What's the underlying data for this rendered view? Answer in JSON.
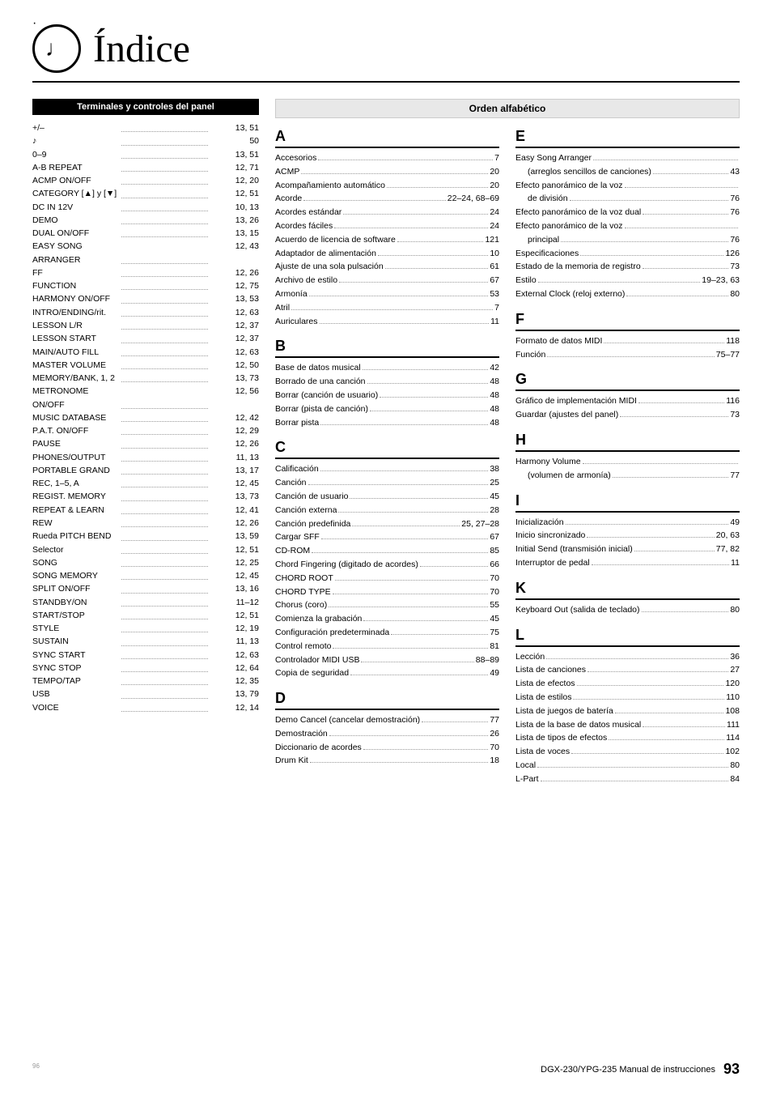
{
  "header": {
    "title": "Índice",
    "icon": "♩"
  },
  "left_panel": {
    "title": "Terminales y controles del panel",
    "entries": [
      {
        "name": "+/–",
        "page": "13, 51"
      },
      {
        "name": "♪",
        "page": "50"
      },
      {
        "name": "0–9",
        "page": "13, 51"
      },
      {
        "name": "A-B REPEAT",
        "page": "12, 71"
      },
      {
        "name": "ACMP ON/OFF",
        "page": "12, 20"
      },
      {
        "name": "CATEGORY [▲] y [▼]",
        "page": "12, 51"
      },
      {
        "name": "DC IN 12V",
        "page": "10, 13"
      },
      {
        "name": "DEMO",
        "page": "13, 26"
      },
      {
        "name": "DUAL ON/OFF",
        "page": "13, 15"
      },
      {
        "name": "EASY SONG ARRANGER",
        "page": "12, 43"
      },
      {
        "name": "FF",
        "page": "12, 26"
      },
      {
        "name": "FUNCTION",
        "page": "12, 75"
      },
      {
        "name": "HARMONY ON/OFF",
        "page": "13, 53"
      },
      {
        "name": "INTRO/ENDING/rit.",
        "page": "12, 63"
      },
      {
        "name": "LESSON L/R",
        "page": "12, 37"
      },
      {
        "name": "LESSON START",
        "page": "12, 37"
      },
      {
        "name": "MAIN/AUTO FILL",
        "page": "12, 63"
      },
      {
        "name": "MASTER VOLUME",
        "page": "12, 50"
      },
      {
        "name": "MEMORY/BANK, 1, 2",
        "page": "13, 73"
      },
      {
        "name": "METRONOME ON/OFF",
        "page": "12, 56"
      },
      {
        "name": "MUSIC DATABASE",
        "page": "12, 42"
      },
      {
        "name": "P.A.T. ON/OFF",
        "page": "12, 29"
      },
      {
        "name": "PAUSE",
        "page": "12, 26"
      },
      {
        "name": "PHONES/OUTPUT",
        "page": "11, 13"
      },
      {
        "name": "PORTABLE GRAND",
        "page": "13, 17"
      },
      {
        "name": "REC, 1–5, A",
        "page": "12, 45"
      },
      {
        "name": "REGIST. MEMORY",
        "page": "13, 73"
      },
      {
        "name": "REPEAT & LEARN",
        "page": "12, 41"
      },
      {
        "name": "REW",
        "page": "12, 26"
      },
      {
        "name": "Rueda PITCH BEND",
        "page": "13, 59"
      },
      {
        "name": "Selector",
        "page": "12, 51"
      },
      {
        "name": "SONG",
        "page": "12, 25"
      },
      {
        "name": "SONG MEMORY",
        "page": "12, 45"
      },
      {
        "name": "SPLIT ON/OFF",
        "page": "13, 16"
      },
      {
        "name": "STANDBY/ON",
        "page": "11–12"
      },
      {
        "name": "START/STOP",
        "page": "12, 51"
      },
      {
        "name": "STYLE",
        "page": "12, 19"
      },
      {
        "name": "SUSTAIN",
        "page": "11, 13"
      },
      {
        "name": "SYNC START",
        "page": "12, 63"
      },
      {
        "name": "SYNC STOP",
        "page": "12, 64"
      },
      {
        "name": "TEMPO/TAP",
        "page": "12, 35"
      },
      {
        "name": "USB",
        "page": "13, 79"
      },
      {
        "name": "VOICE",
        "page": "12, 14"
      }
    ]
  },
  "alpha_index": {
    "header": "Orden alfabético",
    "sections": [
      {
        "letter": "A",
        "entries": [
          {
            "name": "Accesorios",
            "page": "7"
          },
          {
            "name": "ACMP",
            "page": "20"
          },
          {
            "name": "Acompañamiento automático",
            "page": "20"
          },
          {
            "name": "Acorde",
            "page": "22–24, 68–69"
          },
          {
            "name": "Acordes estándar",
            "page": "24"
          },
          {
            "name": "Acordes fáciles",
            "page": "24"
          },
          {
            "name": "Acuerdo de licencia de software",
            "page": "121"
          },
          {
            "name": "Adaptador de alimentación",
            "page": "10"
          },
          {
            "name": "Ajuste de una sola pulsación",
            "page": "61"
          },
          {
            "name": "Archivo de estilo",
            "page": "67"
          },
          {
            "name": "Armonía",
            "page": "53"
          },
          {
            "name": "Atril",
            "page": "7"
          },
          {
            "name": "Auriculares",
            "page": "11"
          }
        ]
      },
      {
        "letter": "B",
        "entries": [
          {
            "name": "Base de datos musical",
            "page": "42"
          },
          {
            "name": "Borrado de una canción",
            "page": "48"
          },
          {
            "name": "Borrar (canción de usuario)",
            "page": "48"
          },
          {
            "name": "Borrar (pista de canción)",
            "page": "48"
          },
          {
            "name": "Borrar pista",
            "page": "48"
          }
        ]
      },
      {
        "letter": "C",
        "entries": [
          {
            "name": "Calificación",
            "page": "38"
          },
          {
            "name": "Canción",
            "page": "25"
          },
          {
            "name": "Canción de usuario",
            "page": "45"
          },
          {
            "name": "Canción externa",
            "page": "28"
          },
          {
            "name": "Canción predefinida",
            "page": "25, 27–28"
          },
          {
            "name": "Cargar SFF",
            "page": "67"
          },
          {
            "name": "CD-ROM",
            "page": "85"
          },
          {
            "name": "Chord Fingering (digitado de acordes)",
            "page": "66"
          },
          {
            "name": "CHORD ROOT",
            "page": "70"
          },
          {
            "name": "CHORD TYPE",
            "page": "70"
          },
          {
            "name": "Chorus (coro)",
            "page": "55"
          },
          {
            "name": "Comienza la grabación",
            "page": "45"
          },
          {
            "name": "Configuración predeterminada",
            "page": "75"
          },
          {
            "name": "Control remoto",
            "page": "81"
          },
          {
            "name": "Controlador MIDI USB",
            "page": "88–89"
          },
          {
            "name": "Copia de seguridad",
            "page": "49"
          }
        ]
      },
      {
        "letter": "D",
        "entries": [
          {
            "name": "Demo Cancel (cancelar demostración)",
            "page": "77"
          },
          {
            "name": "Demostración",
            "page": "26"
          },
          {
            "name": "Diccionario de acordes",
            "page": "70"
          },
          {
            "name": "Drum Kit",
            "page": "18"
          }
        ]
      }
    ]
  },
  "right_sections": [
    {
      "letter": "E",
      "entries": [
        {
          "name": "Easy Song Arranger",
          "page": ""
        },
        {
          "name": "  (arreglos sencillos de canciones)",
          "page": "43"
        },
        {
          "name": "Efecto panorámico de la voz",
          "page": ""
        },
        {
          "name": "  de división",
          "page": "76"
        },
        {
          "name": "Efecto panorámico de la voz dual",
          "page": "76"
        },
        {
          "name": "Efecto panorámico de la voz",
          "page": ""
        },
        {
          "name": "  principal",
          "page": "76"
        },
        {
          "name": "Especificaciones",
          "page": "126"
        },
        {
          "name": "Estado de la memoria de registro",
          "page": "73"
        },
        {
          "name": "Estilo",
          "page": "19–23, 63"
        },
        {
          "name": "External Clock (reloj externo)",
          "page": "80"
        }
      ]
    },
    {
      "letter": "F",
      "entries": [
        {
          "name": "Formato de datos MIDI",
          "page": "118"
        },
        {
          "name": "Función",
          "page": "75–77"
        }
      ]
    },
    {
      "letter": "G",
      "entries": [
        {
          "name": "Gráfico de implementación MIDI",
          "page": "116"
        },
        {
          "name": "Guardar (ajustes del panel)",
          "page": "73"
        }
      ]
    },
    {
      "letter": "H",
      "entries": [
        {
          "name": "Harmony Volume",
          "page": ""
        },
        {
          "name": "  (volumen de armonía)",
          "page": "77"
        }
      ]
    },
    {
      "letter": "I",
      "entries": [
        {
          "name": "Inicialización",
          "page": "49"
        },
        {
          "name": "Inicio sincronizado",
          "page": "20, 63"
        },
        {
          "name": "Initial Send (transmisión inicial)",
          "page": "77, 82"
        },
        {
          "name": "Interruptor de pedal",
          "page": "11"
        }
      ]
    },
    {
      "letter": "K",
      "entries": [
        {
          "name": "Keyboard Out (salida de teclado)",
          "page": "80"
        }
      ]
    },
    {
      "letter": "L",
      "entries": [
        {
          "name": "Lección",
          "page": "36"
        },
        {
          "name": "Lista de canciones",
          "page": "27"
        },
        {
          "name": "Lista de efectos",
          "page": "120"
        },
        {
          "name": "Lista de estilos",
          "page": "110"
        },
        {
          "name": "Lista de juegos de batería",
          "page": "108"
        },
        {
          "name": "Lista de la base de datos musical",
          "page": "111"
        },
        {
          "name": "Lista de tipos de efectos",
          "page": "114"
        },
        {
          "name": "Lista de voces",
          "page": "102"
        },
        {
          "name": "Local",
          "page": "80"
        },
        {
          "name": "L-Part",
          "page": "84"
        }
      ]
    }
  ],
  "footer": {
    "model": "DGX-230/YPG-235  Manual de instrucciones",
    "page": "93"
  }
}
